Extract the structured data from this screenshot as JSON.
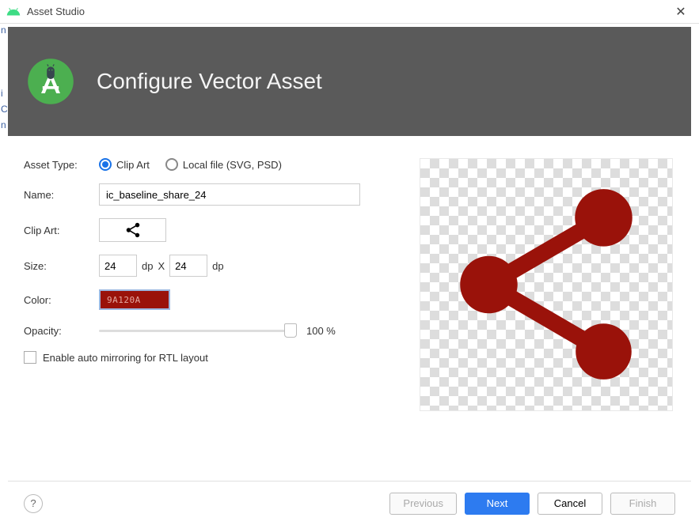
{
  "window": {
    "title": "Asset Studio"
  },
  "header": {
    "title": "Configure Vector Asset"
  },
  "form": {
    "asset_type_label": "Asset Type:",
    "asset_type_clipart": "Clip Art",
    "asset_type_localfile": "Local file (SVG, PSD)",
    "name_label": "Name:",
    "name_value": "ic_baseline_share_24",
    "clipart_label": "Clip Art:",
    "size_label": "Size:",
    "size_width": "24",
    "size_height": "24",
    "size_unit": "dp",
    "size_x": "X",
    "color_label": "Color:",
    "color_value": "9A120A",
    "color_hex": "#9a120a",
    "opacity_label": "Opacity:",
    "opacity_value": "100 %",
    "mirror_label": "Enable auto mirroring for RTL layout"
  },
  "footer": {
    "help": "?",
    "previous": "Previous",
    "next": "Next",
    "cancel": "Cancel",
    "finish": "Finish"
  }
}
